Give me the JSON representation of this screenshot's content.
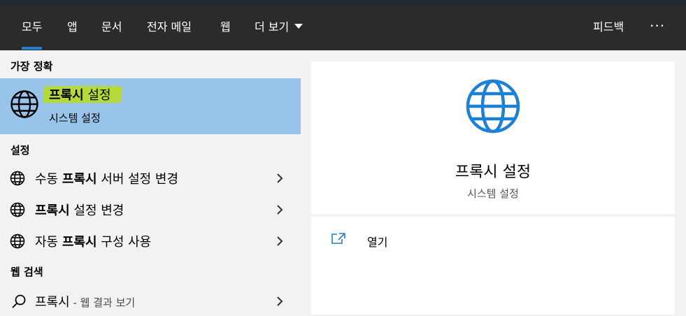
{
  "header": {
    "tabs": [
      {
        "label": "모두",
        "active": true
      },
      {
        "label": "앱"
      },
      {
        "label": "문서"
      },
      {
        "label": "전자 메일"
      },
      {
        "label": "웹"
      },
      {
        "label": "더 보기"
      }
    ],
    "feedback_label": "피드백",
    "more_label": "···"
  },
  "left": {
    "best_match_label": "가장 정확",
    "best_match": {
      "title_bold": "프록시",
      "title_rest": " 설정",
      "subtitle": "시스템 설정",
      "icon": "globe-icon"
    },
    "settings_label": "설정",
    "settings_items": [
      {
        "pre": "수동 ",
        "bold": "프록시",
        "post": " 서버 설정 변경",
        "icon": "globe-icon"
      },
      {
        "pre": "",
        "bold": "프록시",
        "post": " 설정 변경",
        "icon": "globe-icon"
      },
      {
        "pre": "자동 ",
        "bold": "프록시",
        "post": " 구성 사용",
        "icon": "globe-icon"
      }
    ],
    "web_label": "웹 검색",
    "web_item": {
      "query": "프록시",
      "hint": " - 웹 결과 보기",
      "icon": "search-icon"
    }
  },
  "right": {
    "title": "프록시 설정",
    "subtitle": "시스템 설정",
    "open_label": "열기",
    "icon": "globe-icon"
  },
  "colors": {
    "header_bg": "#2b2b2b",
    "accent": "#1d7fd6",
    "selected_bg": "#99c4ea",
    "highlight": "#b5d83a"
  }
}
